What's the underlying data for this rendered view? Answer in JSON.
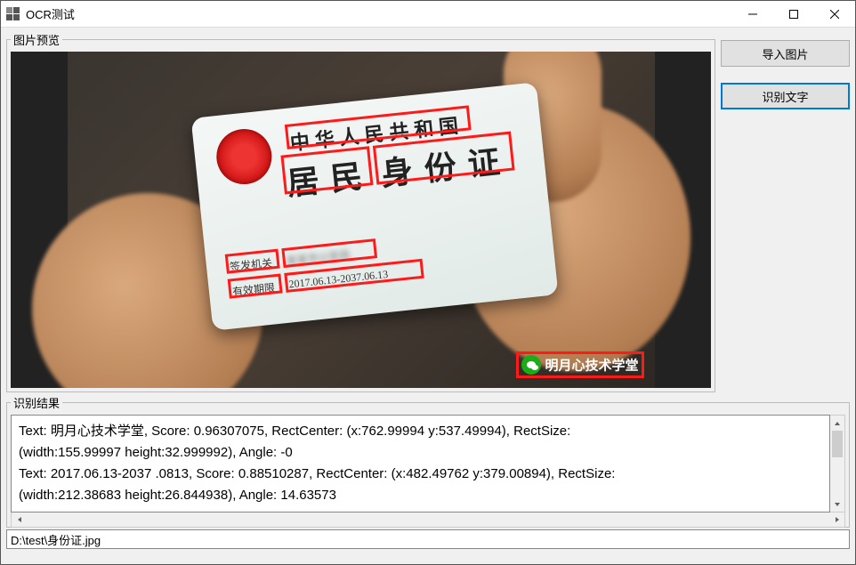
{
  "window": {
    "title": "OCR测试"
  },
  "preview": {
    "group_label": "图片预览"
  },
  "buttons": {
    "import_image": "导入图片",
    "recognize_text": "识别文字"
  },
  "id_card": {
    "line1": "中华人民共和国",
    "line2_a": "居 民",
    "line2_b": "身 份 证",
    "issuer_label": "签发机关",
    "validity_label": "有效期限",
    "validity_value": "2017.06.13-2037.06.13"
  },
  "watermark": {
    "text": "明月心技术学堂"
  },
  "results": {
    "group_label": "识别结果",
    "line1": "Text: 明月心技术学堂, Score: 0.96307075, RectCenter: (x:762.99994 y:537.49994), RectSize:",
    "line2": "(width:155.99997 height:32.999992), Angle: -0",
    "line3": "Text: 2017.06.13-2037 .0813, Score: 0.88510287, RectCenter: (x:482.49762 y:379.00894), RectSize:",
    "line4": "(width:212.38683 height:26.844938), Angle: 14.63573"
  },
  "path_value": "D:\\test\\身份证.jpg"
}
